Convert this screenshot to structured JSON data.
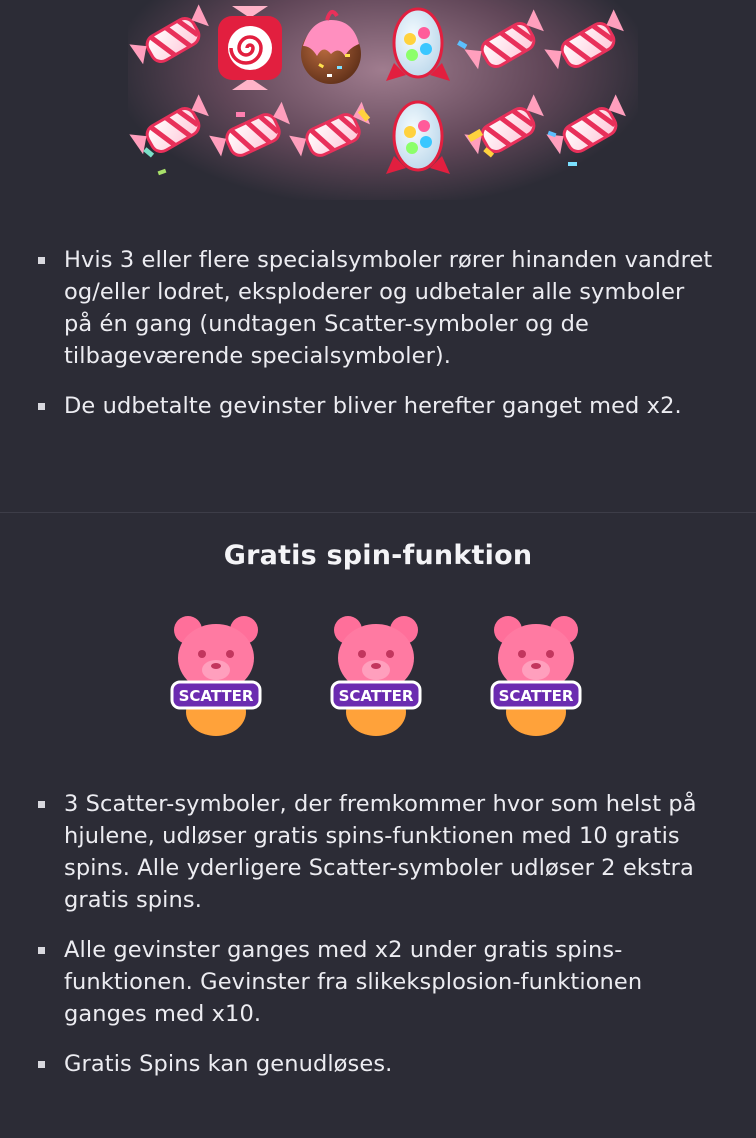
{
  "section1": {
    "items": [
      "Hvis 3 eller flere specialsymboler rører hinanden vandret og/eller lodret, eksploderer og udbetaler alle symboler på én gang (undtagen Scatter-symboler og de tilbageværende specialsymboler).",
      "De udbetalte gevinster bliver herefter ganget med x2."
    ]
  },
  "section2": {
    "title": "Gratis spin-funktion",
    "scatter_label": "SCATTER",
    "items": [
      "3 Scatter-symboler, der fremkommer hvor som helst på hjulene, udløser gratis spins-funktionen med 10 gratis spins. Alle yderligere Scatter-symboler udløser 2 ekstra gratis spins.",
      "Alle gevinster ganges med x2 under gratis spins-funktionen. Gevinster fra slikeksplosion-funktionen ganges med x10.",
      "Gratis Spins kan genudløses."
    ]
  },
  "colors": {
    "background": "#2c2c36",
    "text": "#ececf1",
    "bear_pink": "#ff6f9a",
    "scatter_badge": "#6b2bb0"
  }
}
